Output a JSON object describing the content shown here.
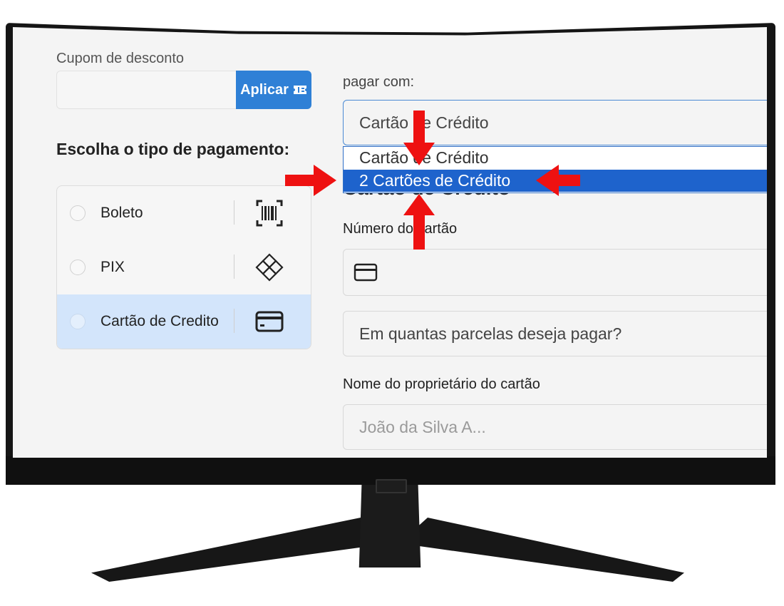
{
  "coupon": {
    "label": "Cupom de desconto",
    "apply_label": "Aplicar",
    "value": ""
  },
  "payment_types": {
    "title": "Escolha o tipo de pagamento:",
    "options": [
      {
        "label": "Boleto",
        "icon": "barcode-icon",
        "selected": false
      },
      {
        "label": "PIX",
        "icon": "pix-icon",
        "selected": false
      },
      {
        "label": "Cartão de Credito",
        "icon": "credit-card-icon",
        "selected": true
      }
    ]
  },
  "pay_with": {
    "label": "pagar com:",
    "selected": "Cartão de Crédito",
    "options": [
      "Cartão de Crédito",
      "2 Cartões de Crédito"
    ],
    "highlighted": "2 Cartões de Crédito"
  },
  "card_form": {
    "section_title": "Cartão de Crédito",
    "card_number_label": "Número do cartão",
    "card_number_value": "",
    "installments_placeholder": "Em quantas parcelas deseja pagar?",
    "owner_label": "Nome do proprietário do cartão",
    "owner_placeholder": "João da Silva A..."
  },
  "colors": {
    "accent": "#2f80d6",
    "highlight": "#1e63cc",
    "selected_bg": "#d3e5fb",
    "arrow": "#ee1111"
  }
}
